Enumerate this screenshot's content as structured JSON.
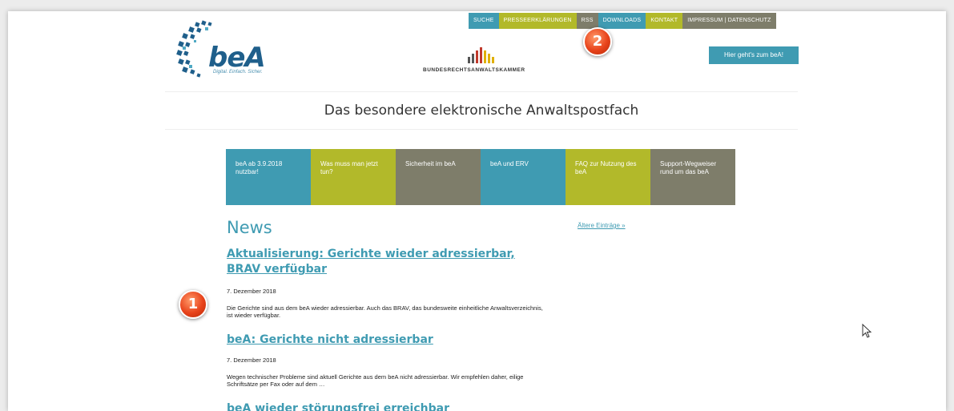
{
  "topnav": {
    "items": [
      {
        "label": "SUCHE",
        "color": "#3f9bb2"
      },
      {
        "label": "PRESSEERKLÄRUNGEN",
        "color": "#b2b92a"
      },
      {
        "label": "RSS",
        "color": "#7e7d6a"
      },
      {
        "label": "DOWNLOADS",
        "color": "#3f9bb2"
      },
      {
        "label": "KONTAKT",
        "color": "#b2b92a"
      },
      {
        "label": "IMPRESSUM | DATENSCHUTZ",
        "color": "#7e7d6a"
      }
    ]
  },
  "logo": {
    "text": "beA",
    "tagline": "Digital. Einfach. Sicher."
  },
  "brak": {
    "name": "BUNDESRECHTSANWALTSKAMMER"
  },
  "cta": {
    "label": "Hier geht's zum beA!"
  },
  "page": {
    "title": "Das besondere elektronische Anwaltspostfach"
  },
  "tiles": [
    {
      "label": "beA ab 3.9.2018 nutzbar!",
      "color": "#3f9bb2"
    },
    {
      "label": "Was muss man jetzt tun?",
      "color": "#b2b92a"
    },
    {
      "label": "Sicherheit im beA",
      "color": "#7e7d6a"
    },
    {
      "label": "beA und ERV",
      "color": "#3f9bb2"
    },
    {
      "label": "FAQ zur Nutzung des beA",
      "color": "#b2b92a"
    },
    {
      "label": "Support-Wegweiser rund um das beA",
      "color": "#7e7d6a"
    }
  ],
  "news": {
    "heading": "News",
    "older_link": "Ältere Einträge »",
    "articles": [
      {
        "title": "Aktualisierung: Gerichte wieder adressierbar, BRAV verfügbar",
        "date": "7. Dezember 2018",
        "text": "Die Gerichte sind aus dem beA wieder adressierbar. Auch das BRAV, das bundesweite einheitliche Anwaltsverzeichnis, ist wieder verfügbar."
      },
      {
        "title": "beA: Gerichte nicht adressierbar",
        "date": "7. Dezember 2018",
        "text": "Wegen technischer Probleme sind aktuell Gerichte aus dem beA nicht adressierbar. Wir empfehlen daher, eilige Schriftsätze per Fax oder auf dem …"
      },
      {
        "title": "beA wieder störungsfrei erreichbar"
      }
    ]
  },
  "badges": {
    "one": "1",
    "two": "2"
  }
}
